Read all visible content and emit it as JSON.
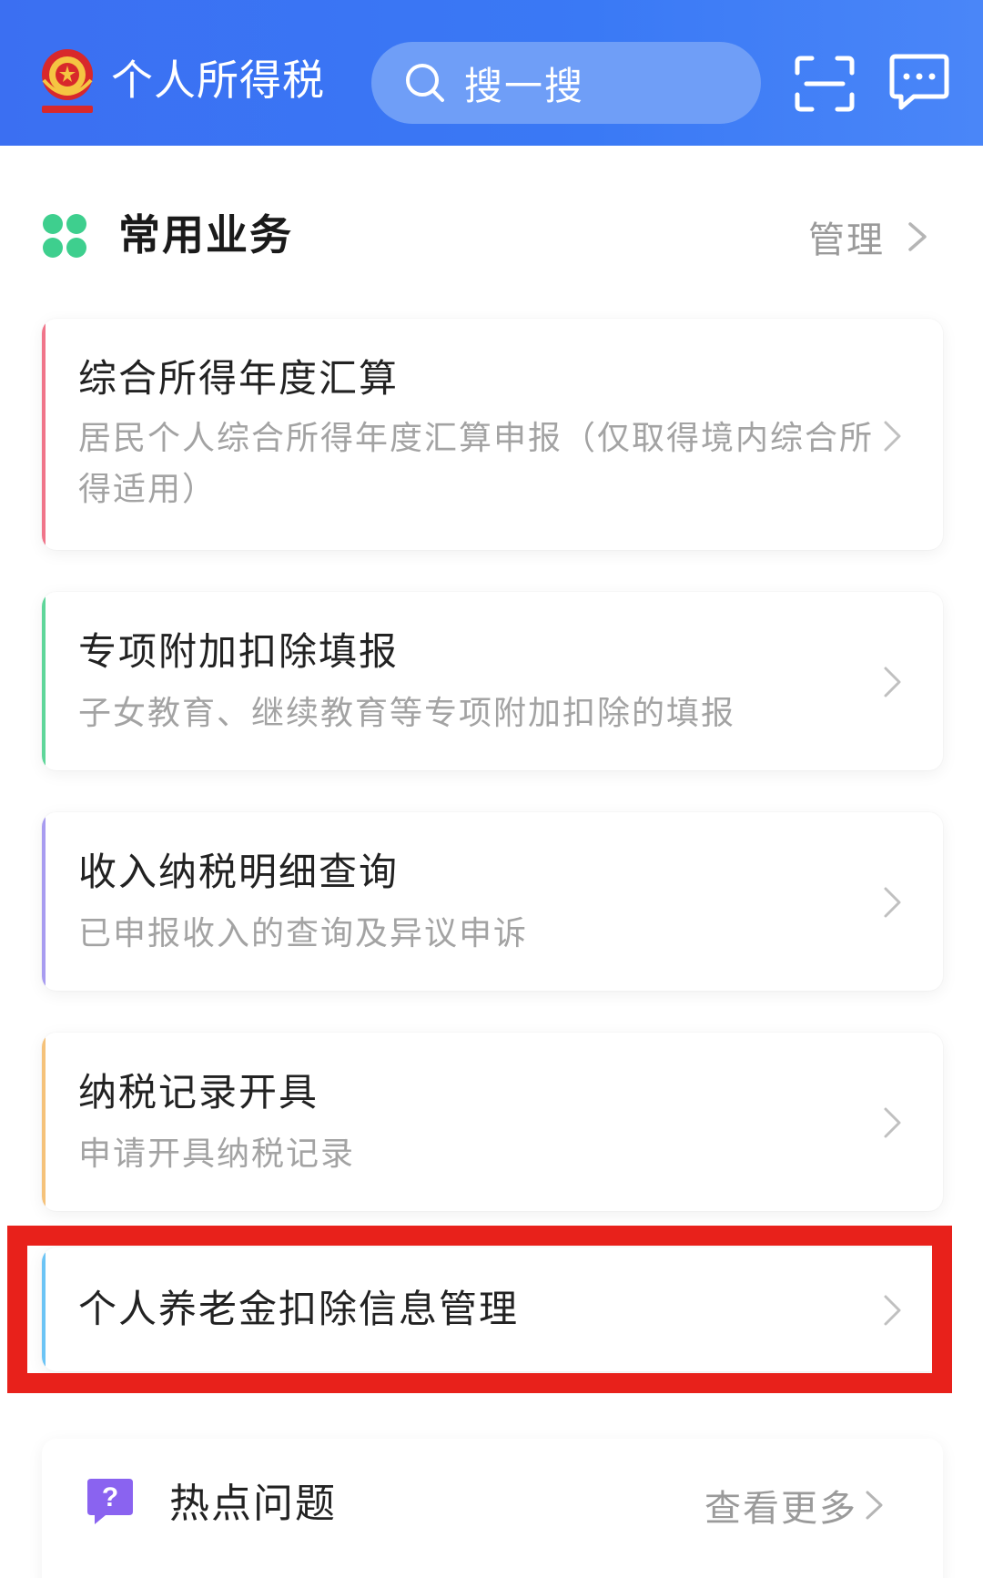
{
  "header": {
    "app_title": "个人所得税",
    "search_placeholder": "搜一搜",
    "background_color": "#3b6ff2",
    "icons": [
      "national-emblem-icon",
      "search-icon",
      "scan-icon",
      "message-icon"
    ]
  },
  "common_services": {
    "title": "常用业务",
    "manage_label": "管理",
    "section_icon": "grid-icon",
    "section_icon_color": "#3ecf8e",
    "items": [
      {
        "title": "综合所得年度汇算",
        "description": "居民个人综合所得年度汇算申报（仅取得境内综合所得适用）",
        "accent_color": "#f0758a"
      },
      {
        "title": "专项附加扣除填报",
        "description": "子女教育、继续教育等专项附加扣除的填报",
        "accent_color": "#5fd69a"
      },
      {
        "title": "收入纳税明细查询",
        "description": "已申报收入的查询及异议申诉",
        "accent_color": "#a89cf0"
      },
      {
        "title": "纳税记录开具",
        "description": "申请开具纳税记录",
        "accent_color": "#f5c27a"
      },
      {
        "title": "个人养老金扣除信息管理",
        "description": "",
        "accent_color": "#6cc4f5",
        "highlighted": true,
        "highlight_color": "#e8211b"
      }
    ]
  },
  "hot_questions": {
    "title": "热点问题",
    "more_label": "查看更多",
    "icon": "question-icon",
    "icon_color": "#8a63f0"
  }
}
